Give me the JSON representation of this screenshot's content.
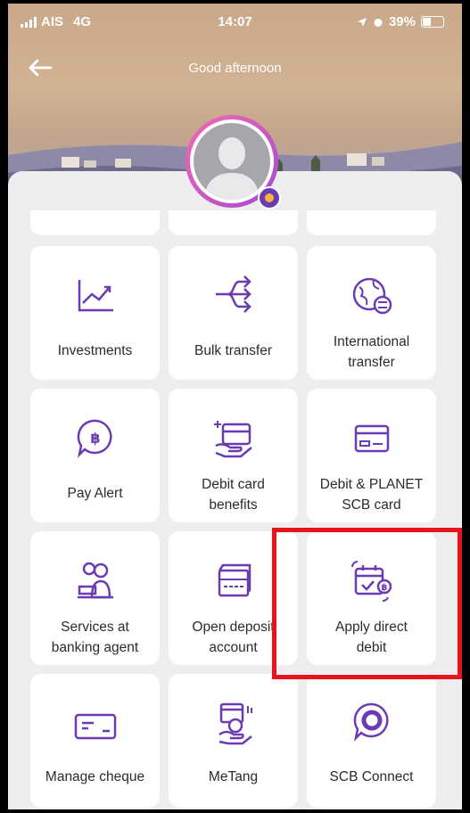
{
  "status_bar": {
    "carrier": "AIS",
    "network": "4G",
    "time": "14:07",
    "battery": "39%"
  },
  "header": {
    "greeting": "Good afternoon"
  },
  "menu": {
    "investments": "Investments",
    "bulk_transfer": "Bulk transfer",
    "international_transfer": "International\ntransfer",
    "pay_alert": "Pay Alert",
    "debit_card_benefits": "Debit card\nbenefits",
    "debit_planet_card": "Debit & PLANET\nSCB card",
    "banking_agent": "Services at\nbanking agent",
    "open_deposit": "Open deposit\naccount",
    "apply_direct_debit": "Apply direct\ndebit",
    "manage_cheque": "Manage cheque",
    "metang": "MeTang",
    "scb_connect": "SCB Connect"
  },
  "colors": {
    "accent": "#6a3bb3",
    "highlight": "#e8141b",
    "background": "#efedf0"
  }
}
